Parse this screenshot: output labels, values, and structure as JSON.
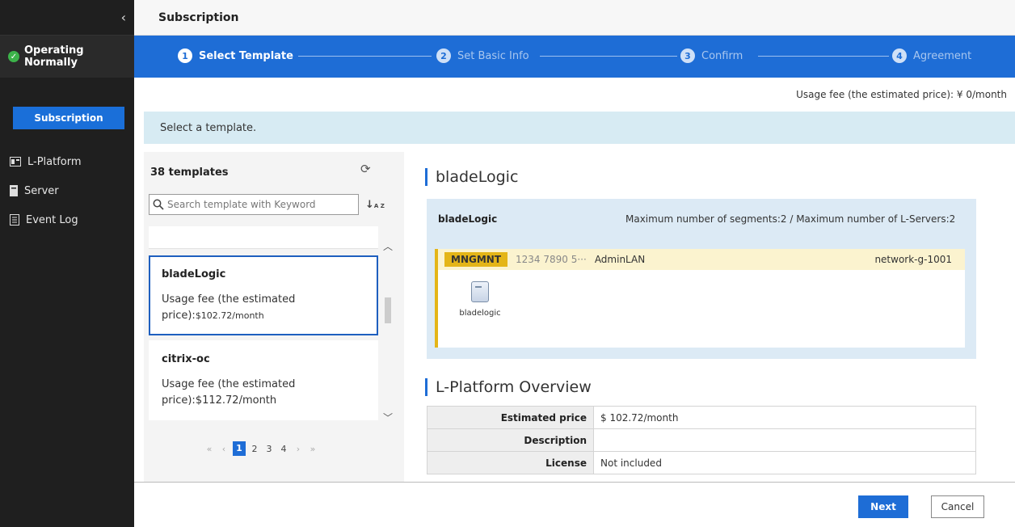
{
  "sidebar": {
    "collapse_icon": "chevron-left-icon",
    "status": "Operating Normally",
    "subscription_label": "Subscription",
    "items": [
      {
        "label": "L-Platform",
        "icon": "l-platform-icon"
      },
      {
        "label": "Server",
        "icon": "server-icon"
      },
      {
        "label": "Event Log",
        "icon": "event-log-icon"
      }
    ]
  },
  "header": {
    "title": "Subscription"
  },
  "steps": [
    {
      "num": "1",
      "label": "Select Template",
      "state": "active"
    },
    {
      "num": "2",
      "label": "Set Basic Info",
      "state": "inactive"
    },
    {
      "num": "3",
      "label": "Confirm",
      "state": "inactive"
    },
    {
      "num": "4",
      "label": "Agreement",
      "state": "inactive"
    }
  ],
  "usage_fee": "Usage fee (the estimated price): ¥ 0/month",
  "banner": "Select a template.",
  "templates": {
    "count": "38 templates",
    "search_placeholder": "Search template with Keyword",
    "sort_label": "↓",
    "sort_sub": "A Z",
    "items": [
      {
        "name": "bladeLogic",
        "fee_prefix": "Usage fee (the estimated price):",
        "fee_price": "$102.72/month",
        "selected": true
      },
      {
        "name": "citrix-oc",
        "fee_prefix": "Usage fee (the estimated price):",
        "fee_price": "$112.72/month",
        "selected": false
      }
    ],
    "pagination": {
      "first": "«",
      "prev": "‹",
      "pages": [
        "1",
        "2",
        "3",
        "4"
      ],
      "current": "1",
      "next": "›",
      "last": "»"
    }
  },
  "detail": {
    "title": "bladeLogic",
    "network": {
      "name": "bladeLogic",
      "max_text": "Maximum number of segments:2 / Maximum number of L-Servers:2",
      "segment": {
        "tag": "MNGMNT",
        "nums": "1234  7890   5···",
        "admin": "AdminLAN",
        "network": "network-g-1001"
      },
      "server_label": "bladelogic"
    },
    "overview_title": "L-Platform Overview",
    "overview_rows": [
      {
        "key": "Estimated price",
        "value": "$ 102.72/month"
      },
      {
        "key": "Description",
        "value": ""
      },
      {
        "key": "License",
        "value": "Not included"
      }
    ]
  },
  "footer": {
    "next": "Next",
    "cancel": "Cancel"
  },
  "colors": {
    "accent": "#1e6dd6",
    "sidebar_bg": "#1f1f1f",
    "banner_bg": "#d7ebf3",
    "segment_tag": "#e4b518",
    "status_ok": "#3cb34a"
  }
}
